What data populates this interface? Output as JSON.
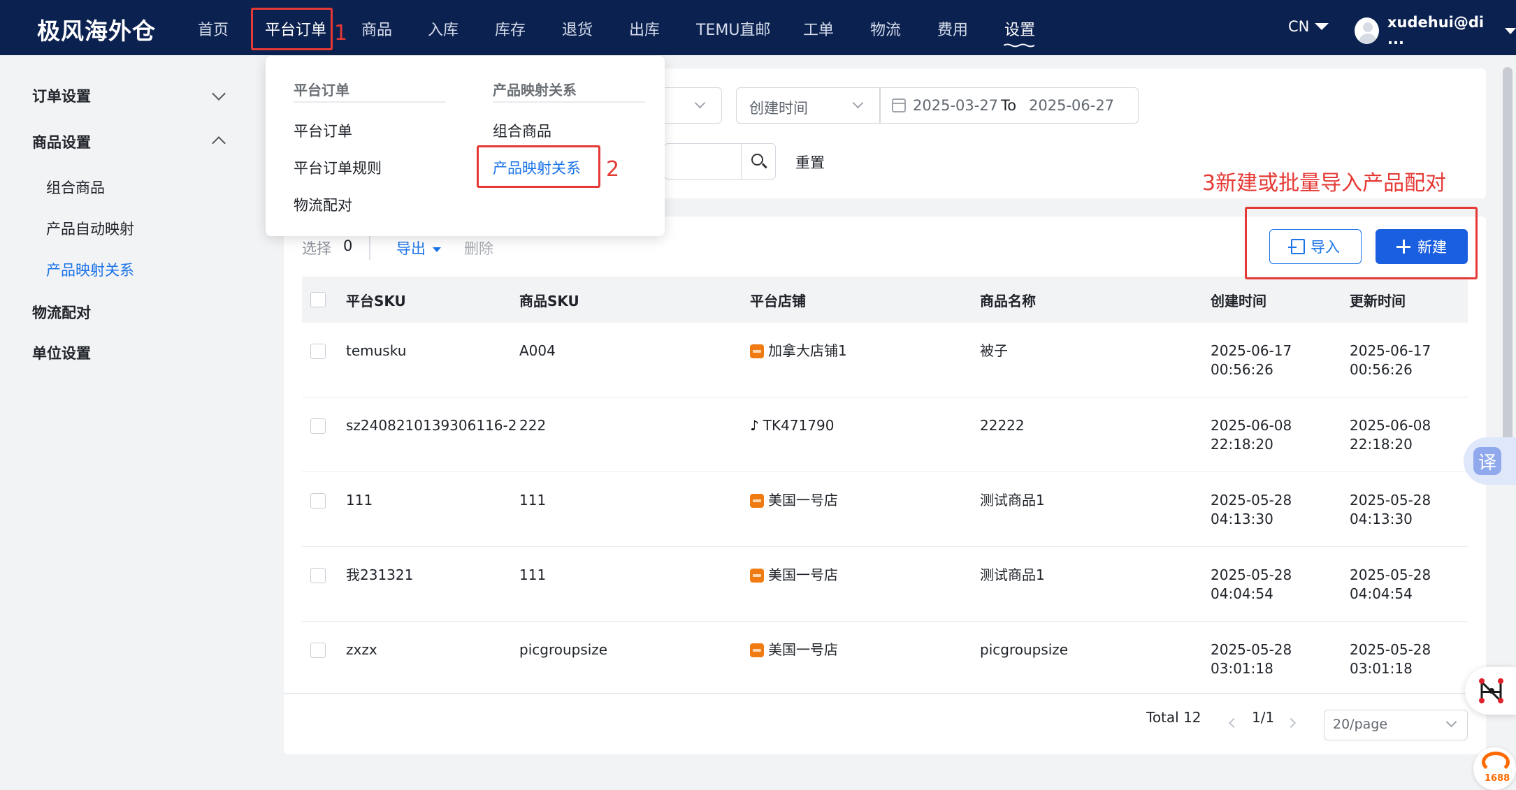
{
  "brand": "极风海外仓",
  "nav": {
    "items": [
      "首页",
      "平台订单",
      "商品",
      "入库",
      "库存",
      "退货",
      "出库",
      "TEMU直邮",
      "工单",
      "物流",
      "费用",
      "设置"
    ],
    "lang": "CN",
    "user": "xudehui@di ..."
  },
  "annotations": {
    "step1": "1",
    "step2": "2",
    "step3": "3新建或批量导入产品配对"
  },
  "sidebar": {
    "groups": {
      "order_settings": "订单设置",
      "product_settings": "商品设置",
      "logistics_pairing": "物流配对",
      "unit_settings": "单位设置"
    },
    "sub_items": [
      "组合商品",
      "产品自动映射",
      "产品映射关系"
    ]
  },
  "dropdown": {
    "col1_title": "平台订单",
    "col1_items": [
      "平台订单",
      "平台订单规则",
      "物流配对"
    ],
    "col2_title": "产品映射关系",
    "col2_items": [
      "组合商品",
      "产品映射关系"
    ]
  },
  "filter": {
    "time_type": "创建时间",
    "date_start": "2025-03-27",
    "date_sep": "To",
    "date_end": "2025-06-27",
    "reset": "重置"
  },
  "toolbar": {
    "select_label": "选择",
    "select_count": "0",
    "export": "导出",
    "delete": "删除",
    "import": "导入",
    "new": "新建"
  },
  "table": {
    "columns": [
      "平台SKU",
      "商品SKU",
      "平台店铺",
      "商品名称",
      "创建时间",
      "更新时间"
    ],
    "rows": [
      {
        "platform_sku": "temusku",
        "product_sku": "A004",
        "shop": "加拿大店铺1",
        "shop_icon": "temu-icon",
        "name": "被子",
        "created_date": "2025-06-17",
        "created_time": "00:56:26",
        "updated_date": "2025-06-17",
        "updated_time": "00:56:26"
      },
      {
        "platform_sku": "sz2408210139306116-2",
        "product_sku": "222",
        "shop": "TK471790",
        "shop_icon": "tiktok-icon",
        "name": "22222",
        "created_date": "2025-06-08",
        "created_time": "22:18:20",
        "updated_date": "2025-06-08",
        "updated_time": "22:18:20"
      },
      {
        "platform_sku": "111",
        "product_sku": "111",
        "shop": "美国一号店",
        "shop_icon": "temu-icon",
        "name": "测试商品1",
        "created_date": "2025-05-28",
        "created_time": "04:13:30",
        "updated_date": "2025-05-28",
        "updated_time": "04:13:30"
      },
      {
        "platform_sku": "我231321",
        "product_sku": "111",
        "shop": "美国一号店",
        "shop_icon": "temu-icon",
        "name": "测试商品1",
        "created_date": "2025-05-28",
        "created_time": "04:04:54",
        "updated_date": "2025-05-28",
        "updated_time": "04:04:54"
      },
      {
        "platform_sku": "zxzx",
        "product_sku": "picgroupsize",
        "shop": "美国一号店",
        "shop_icon": "temu-icon",
        "name": "picgroupsize",
        "created_date": "2025-05-28",
        "created_time": "03:01:18",
        "updated_date": "2025-05-28",
        "updated_time": "03:01:18"
      }
    ]
  },
  "pagination": {
    "total": "Total 12",
    "page": "1/1",
    "page_size": "20/page"
  },
  "widgets": {
    "translate": "译",
    "logo_1688": "1688"
  },
  "colors": {
    "nav_bg": "#0b2150",
    "accent": "#1a73e8",
    "annotation_red": "#e53935"
  }
}
